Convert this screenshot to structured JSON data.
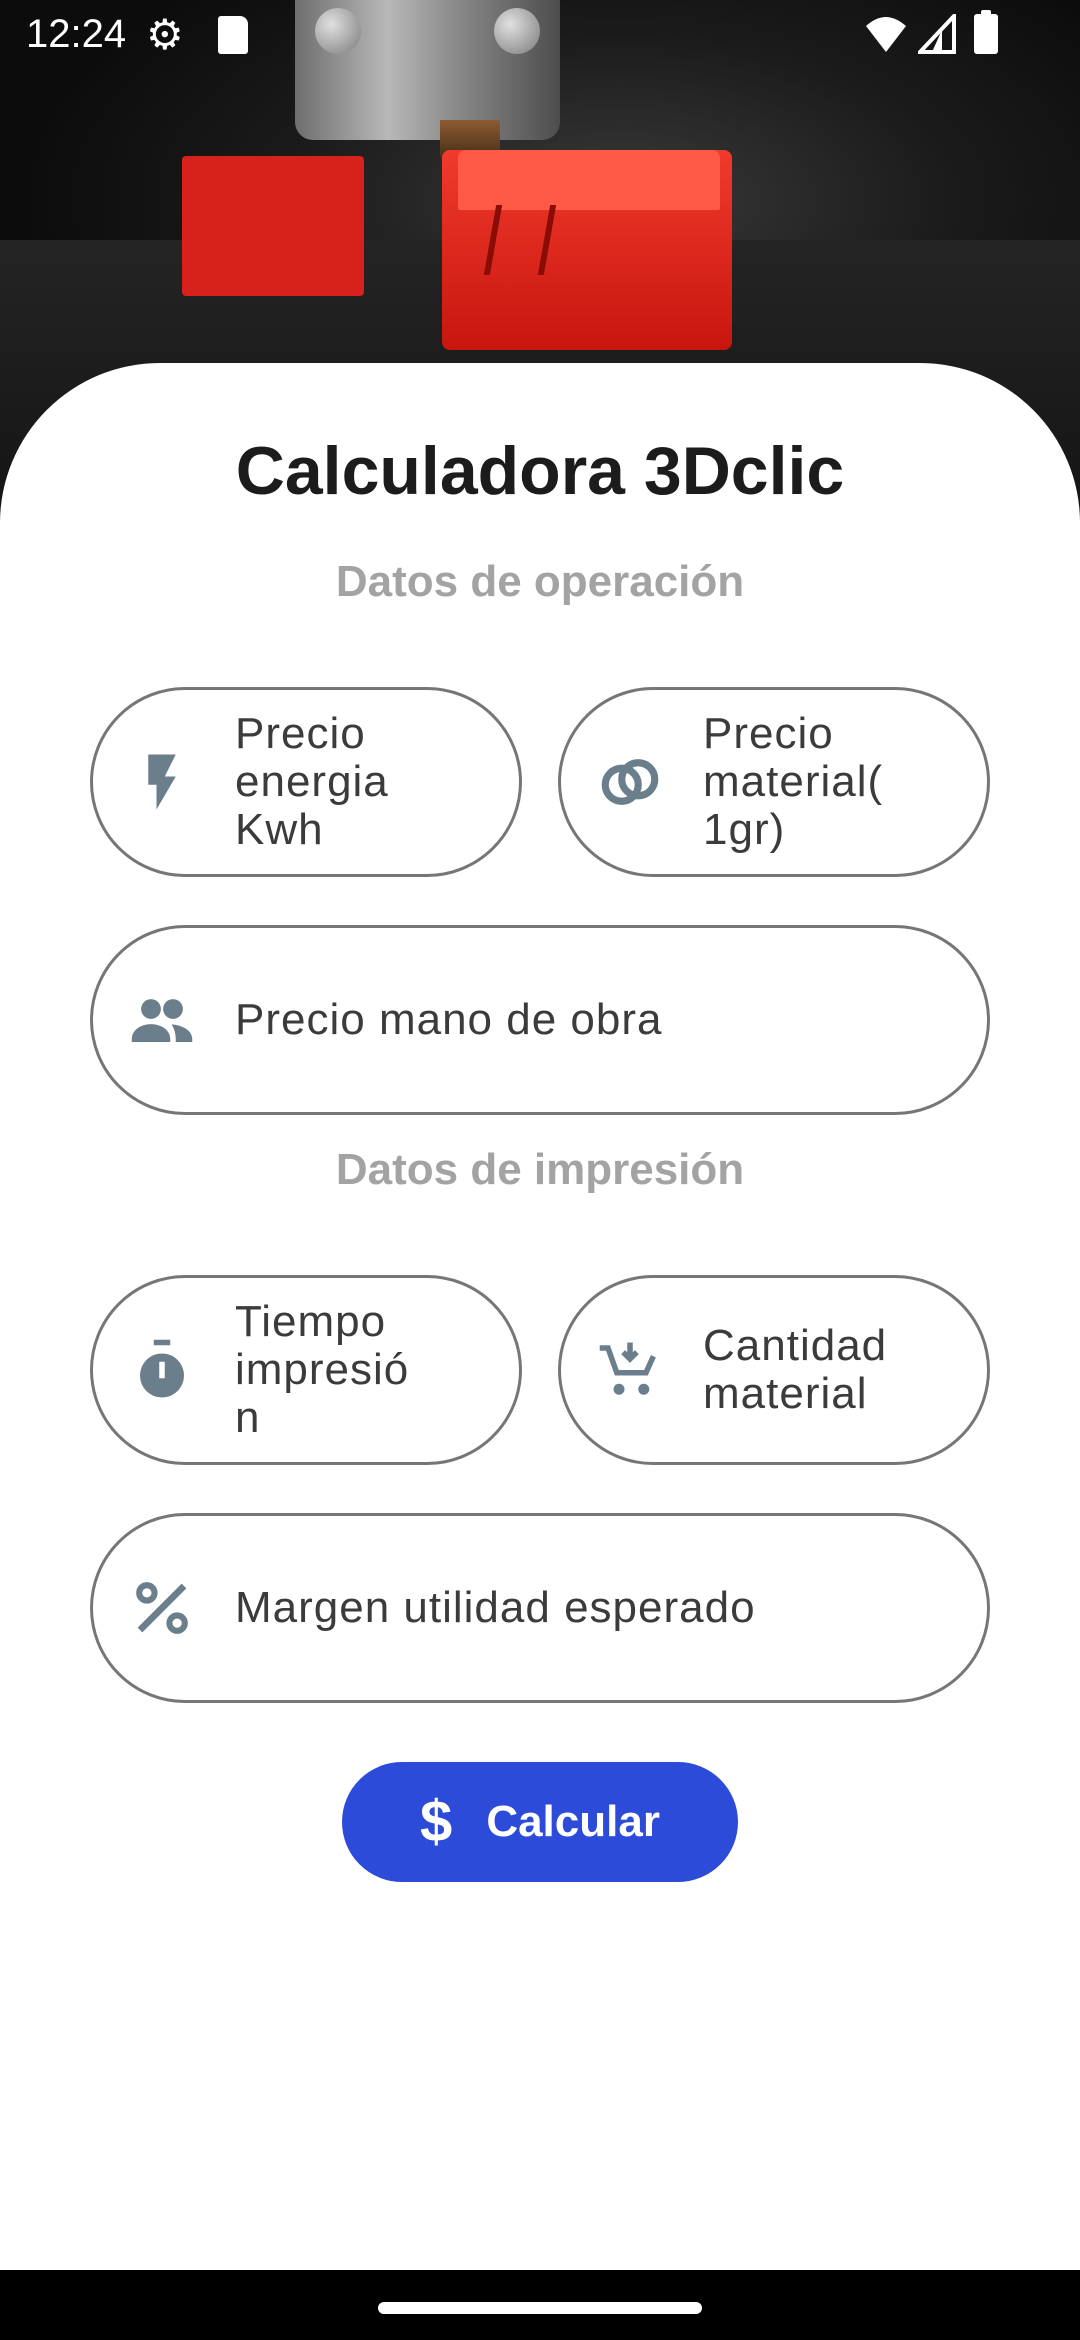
{
  "status_bar": {
    "time": "12:24",
    "icons": [
      "settings-gear-icon",
      "sd-card-icon",
      "wifi-icon",
      "signal-icon",
      "battery-icon"
    ]
  },
  "hero": {
    "image_description_icon": "3d-printer-photo"
  },
  "app": {
    "title": "Calculadora 3Dclic"
  },
  "sections": {
    "operation": "Datos de operación",
    "printing": "Datos de impresión"
  },
  "fields": {
    "energy_price": {
      "label": "Precio\nenergia\nKwh",
      "icon": "bolt-icon"
    },
    "material_price": {
      "label": "Precio\nmaterial(\n1gr)",
      "icon": "filament-rings-icon"
    },
    "labor_price": {
      "label": "Precio mano de obra",
      "icon": "people-icon"
    },
    "print_time": {
      "label": "Tiempo\nimpresió\nn",
      "icon": "timer-icon"
    },
    "material_qty": {
      "label": "Cantidad\nmaterial",
      "icon": "cart-icon"
    },
    "profit_margin": {
      "label": "Margen utilidad esperado",
      "icon": "percent-icon"
    }
  },
  "button": {
    "label": "Calcular",
    "icon": "dollar-icon",
    "icon_glyph": "$"
  },
  "colors": {
    "accent": "#2c4bd8",
    "section_text": "#a3a3a3",
    "icon": "#6a7e8c",
    "field_border": "#767676"
  }
}
